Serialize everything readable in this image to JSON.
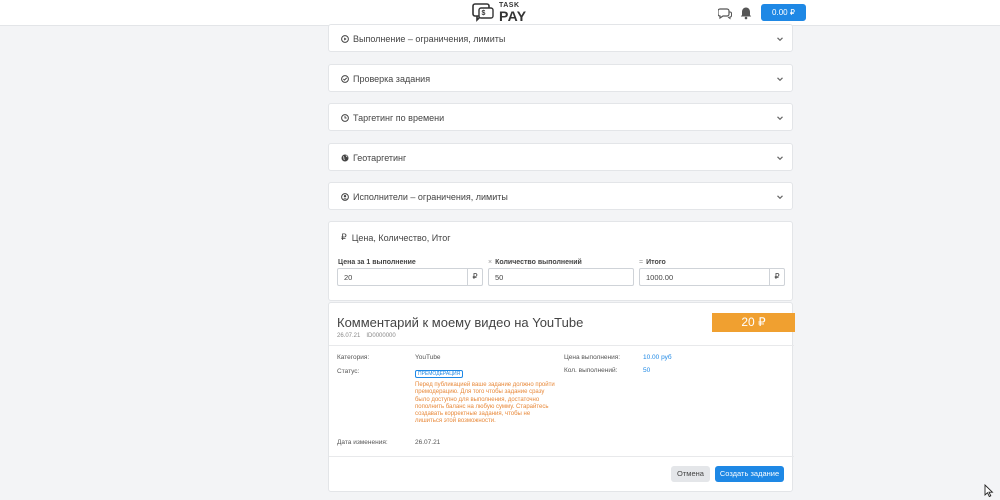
{
  "header": {
    "logo_top": "TASK",
    "logo_bottom": "PAY",
    "balance": "0.00 ₽"
  },
  "accordions": [
    {
      "icon": "play-circle-icon",
      "label": "Выполнение – ограничения, лимиты"
    },
    {
      "icon": "check-circle-icon",
      "label": "Проверка задания"
    },
    {
      "icon": "clock-icon",
      "label": "Таргетинг по времени"
    },
    {
      "icon": "globe-icon",
      "label": "Геотаргетинг"
    },
    {
      "icon": "user-circle-icon",
      "label": "Исполнители – ограничения, лимиты"
    }
  ],
  "price_section": {
    "icon": "ruble-icon",
    "title": "Цена, Количество, Итог",
    "price_label": "Цена за 1 выполнение",
    "price_value": "20",
    "price_suffix": "₽",
    "qty_operator": "×",
    "qty_label": "Количество выполнений",
    "qty_value": "50",
    "total_operator": "=",
    "total_label": "Итого",
    "total_value": "1000.00",
    "total_suffix": "₽"
  },
  "task": {
    "title": "Комментарий к моему видео на YouTube",
    "date": "26.07.21",
    "id": "ID0000000",
    "price_badge": "20 ₽",
    "category_label": "Категория:",
    "category_value": "YouTube",
    "status_label": "Статус:",
    "status_value": "ПРЕМОДЕРАЦИЯ",
    "note": "Перед публикацией ваше задание должно пройти премодерацию. Для того чтобы задание сразу было доступно для выполнения, достаточно пополнить баланс на любую сумму. Старайтесь создавать корректные задания, чтобы не лишиться этой возможности.",
    "modified_label": "Дата изменения:",
    "modified_value": "26.07.21",
    "exec_price_label": "Цена выполнения:",
    "exec_price_value": "10.00 руб",
    "exec_count_label": "Кол. выполнений:",
    "exec_count_value": "50"
  },
  "actions": {
    "cancel": "Отмена",
    "create": "Создать задание"
  },
  "colors": {
    "primary": "#1e88e5",
    "accent": "#f0a030",
    "note": "#e8893a"
  }
}
